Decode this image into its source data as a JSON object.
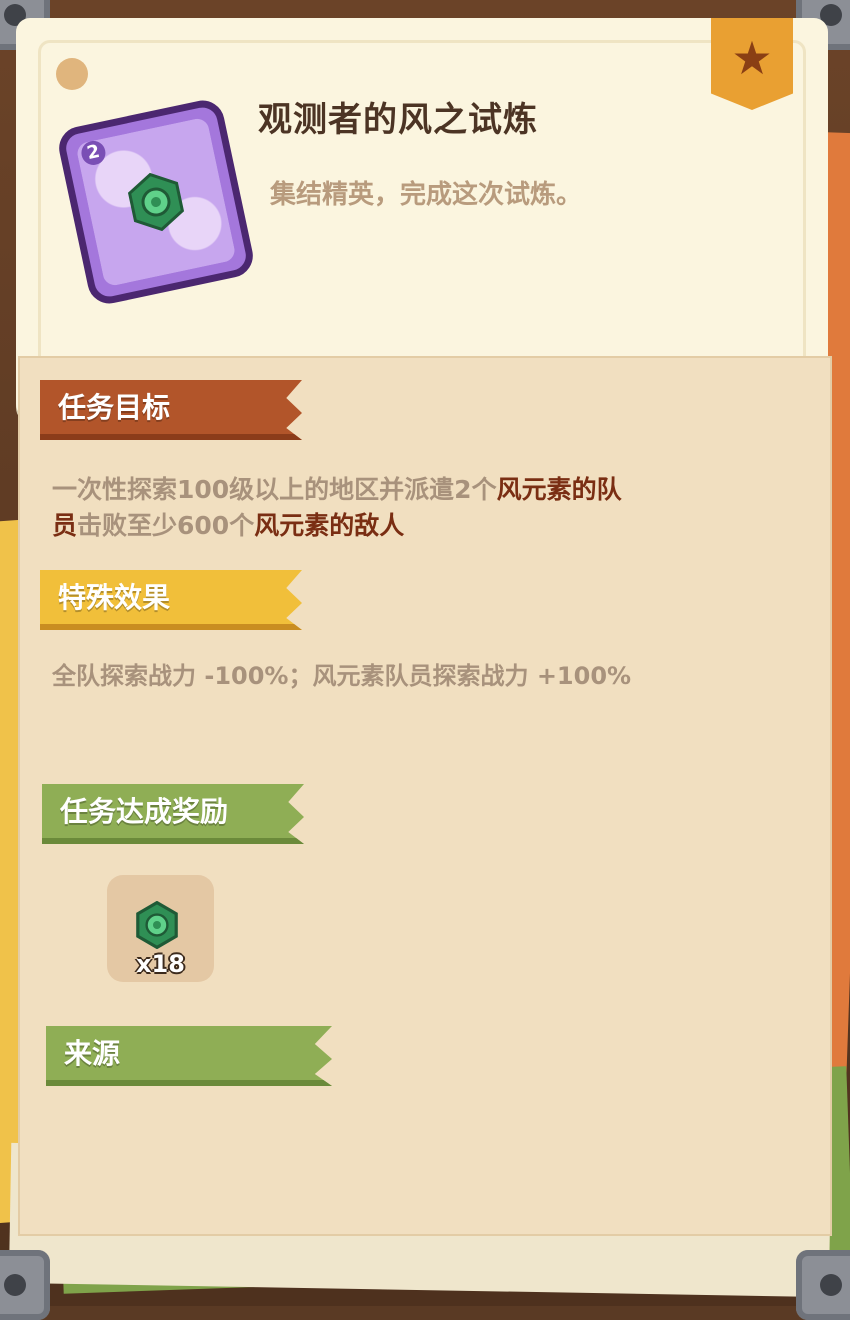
{
  "quest": {
    "card_number": "2",
    "title": "观测者的风之试炼",
    "subtitle": "集结精英，完成这次试炼。",
    "badge_icon": "star-icon"
  },
  "objective": {
    "header": "任务目标",
    "text_parts": {
      "p1": "一次性探索100级以上的地区并派遣2个",
      "p2": "风元素的队",
      "p3": "员",
      "p4": "击败至少600个",
      "p5": "风元素的敌人"
    }
  },
  "special": {
    "header": "特殊效果",
    "text": "全队探索战力 -100%；风元素队员探索战力 +100%"
  },
  "reward": {
    "header": "任务达成奖励",
    "items": [
      {
        "icon": "wind-element-gem-icon",
        "count": "x18"
      }
    ]
  },
  "source": {
    "header": "来源"
  },
  "colors": {
    "objective_ribbon": "#b2552a",
    "special_ribbon": "#f1bf3a",
    "reward_ribbon": "#8fae55",
    "highlight_text": "#7a2e13"
  }
}
